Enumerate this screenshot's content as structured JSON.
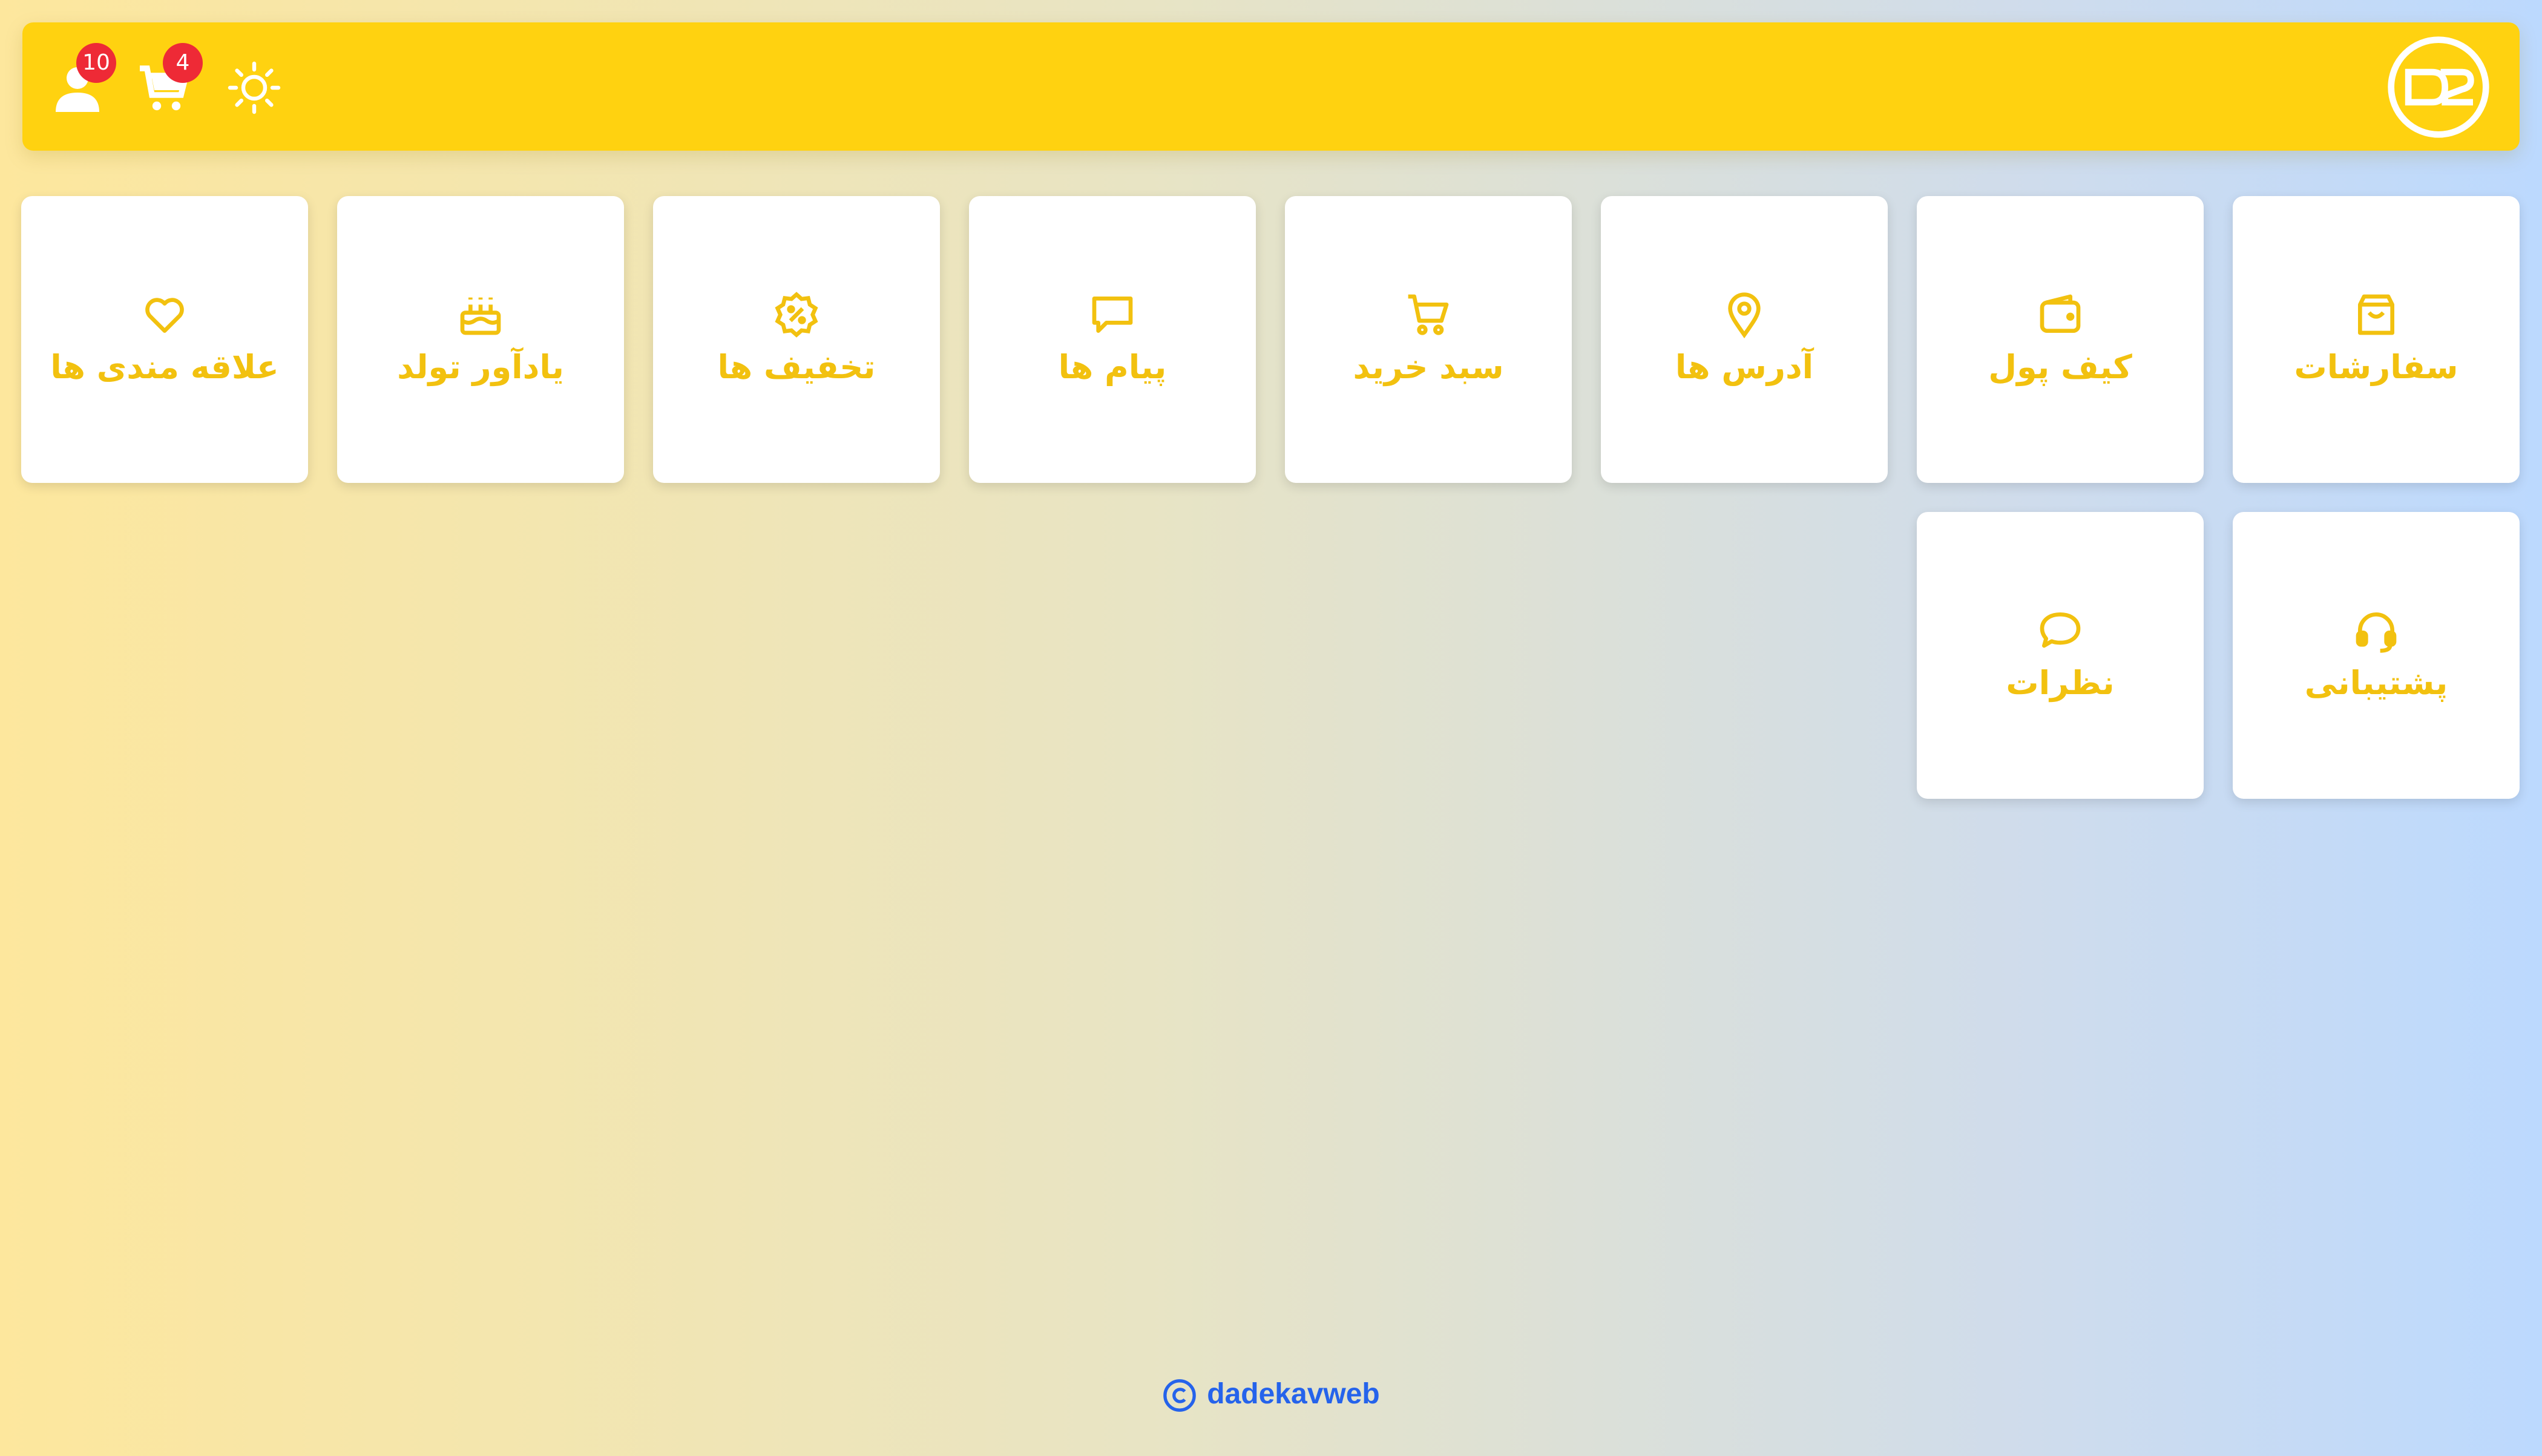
{
  "header": {
    "logo_icon": "dadekav-logo-icon",
    "user_badge": "10",
    "cart_badge": "4",
    "icons": [
      "user-icon",
      "cart-icon",
      "sun-icon"
    ]
  },
  "menu": [
    {
      "label": "سفارشات",
      "icon": "shopping-bag-icon"
    },
    {
      "label": "کیف پول",
      "icon": "wallet-icon"
    },
    {
      "label": "آدرس ها",
      "icon": "map-pin-icon"
    },
    {
      "label": "سبد خرید",
      "icon": "cart-icon"
    },
    {
      "label": "پیام ها",
      "icon": "message-icon"
    },
    {
      "label": "تخفیف ها",
      "icon": "discount-icon"
    },
    {
      "label": "یادآور تولد",
      "icon": "cake-icon"
    },
    {
      "label": "علاقه مندی ها",
      "icon": "heart-icon"
    },
    {
      "label": "پشتیبانی",
      "icon": "headset-icon"
    },
    {
      "label": "نظرات",
      "icon": "comment-icon"
    }
  ],
  "footer": {
    "text": "dadekavweb",
    "icon": "copyright-icon"
  },
  "colors": {
    "accent": "#ffd210",
    "icon": "#f2c10f",
    "badge": "#ee2a36",
    "footer": "#2563eb"
  }
}
